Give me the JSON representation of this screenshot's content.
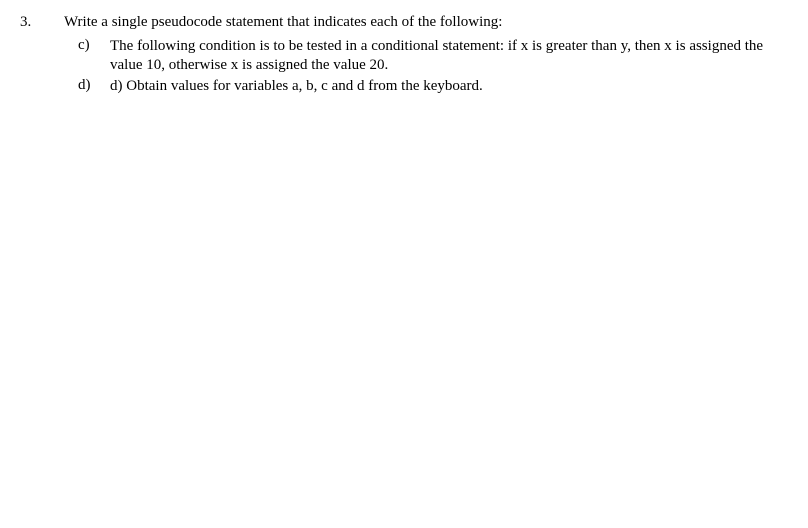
{
  "question": {
    "number": "3.",
    "title": "Write a single pseudocode statement that indicates each of the following:",
    "items": [
      {
        "label": "c)",
        "text": "The following condition is to be tested in a conditional statement: if x is greater than y, then x is assigned the value 10, otherwise x is assigned the value 20."
      },
      {
        "label": "d)",
        "text": "d) Obtain values for variables a, b, c and d from the keyboard."
      }
    ]
  }
}
